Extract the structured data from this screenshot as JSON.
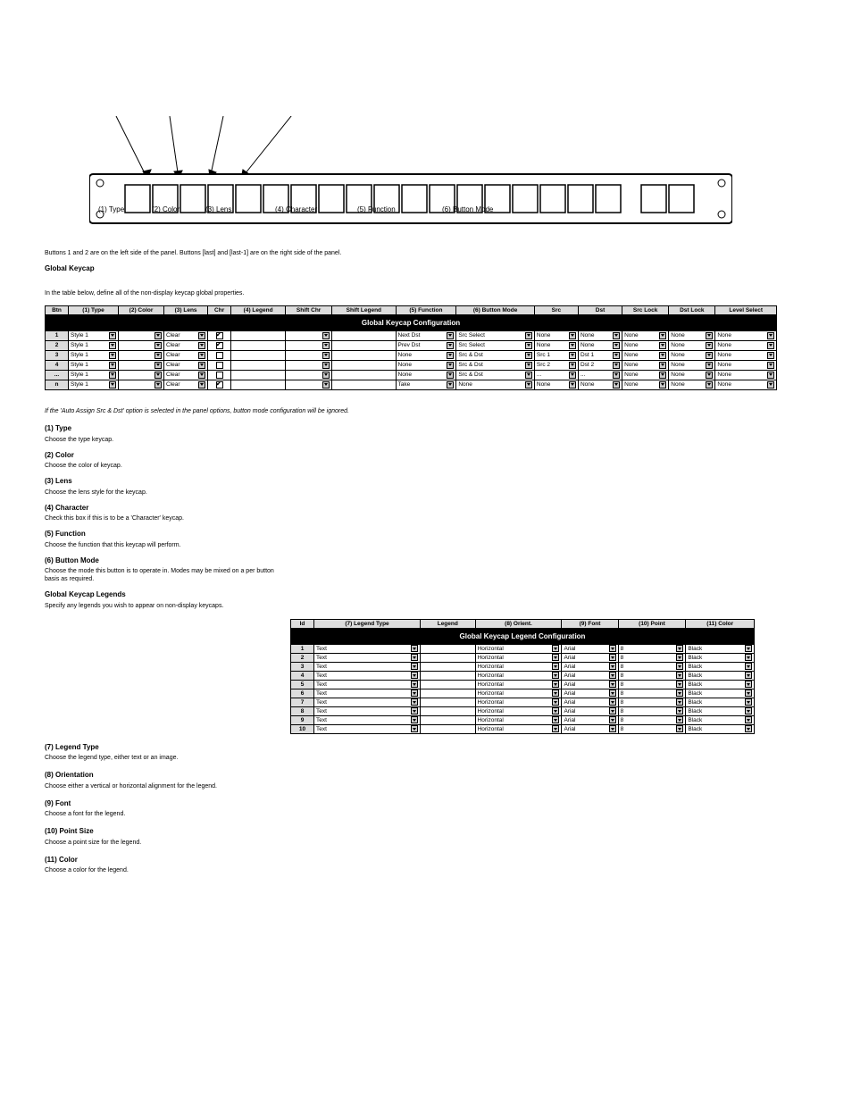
{
  "top_labels": {
    "a": "(1) Type",
    "b": "(2) Color",
    "c": "(3) Lens",
    "d": "(4) Character",
    "e": "(5) Function",
    "f": "(6) Button Mode"
  },
  "panel": {
    "button_count": 18,
    "special_count": 2
  },
  "notes": {
    "arrange_line": "Buttons 1 and 2 are on the left side of the panel. Buttons [last] and [last-1] are on the right side of the panel.",
    "arrange_heading": "Global Keycap",
    "arrange_body": "In the table below, define all of the non-display keycap global properties.",
    "warning": "If the 'Auto Assign Src & Dst' option is selected in the panel options, button mode configuration will be ignored."
  },
  "table_keycap": {
    "title": "Global Keycap Configuration",
    "headers": [
      "Btn",
      "(1) Type",
      "(2) Color",
      "(3) Lens",
      "Chr",
      "(4) Legend",
      "Shift Chr",
      "Shift Legend",
      "(5) Function",
      "(6) Button Mode",
      "Src",
      "Dst",
      "Src Lock",
      "Dst Lock",
      "Level Select"
    ],
    "rows": [
      {
        "btn": "1",
        "type": "Style 1",
        "lens": "Clear",
        "chr_checked": true,
        "legend": "",
        "shift_legend": "",
        "function": "Next Dst",
        "mode": "Src Select",
        "src": "None",
        "dst": "None",
        "src_lock": "None",
        "dst_lock": "None",
        "level": "None"
      },
      {
        "btn": "2",
        "type": "Style 1",
        "lens": "Clear",
        "chr_checked": true,
        "legend": "",
        "shift_legend": "",
        "function": "Prev Dst",
        "mode": "Src Select",
        "src": "None",
        "dst": "None",
        "src_lock": "None",
        "dst_lock": "None",
        "level": "None"
      },
      {
        "btn": "3",
        "type": "Style 1",
        "lens": "Clear",
        "chr_checked": false,
        "legend": "",
        "shift_legend": "",
        "function": "None",
        "mode": "Src & Dst",
        "src": "Src 1",
        "dst": "Dst 1",
        "src_lock": "None",
        "dst_lock": "None",
        "level": "None"
      },
      {
        "btn": "4",
        "type": "Style 1",
        "lens": "Clear",
        "chr_checked": false,
        "legend": "",
        "shift_legend": "",
        "function": "None",
        "mode": "Src & Dst",
        "src": "Src 2",
        "dst": "Dst 2",
        "src_lock": "None",
        "dst_lock": "None",
        "level": "None"
      },
      {
        "btn": "...",
        "type": "Style 1",
        "lens": "Clear",
        "chr_checked": false,
        "legend": "",
        "shift_legend": "",
        "function": "None",
        "mode": "Src & Dst",
        "src": "...",
        "dst": "...",
        "src_lock": "None",
        "dst_lock": "None",
        "level": "None"
      },
      {
        "btn": "n",
        "type": "Style 1",
        "lens": "Clear",
        "chr_checked": true,
        "legend": "",
        "shift_legend": "",
        "function": "Take",
        "mode": "None",
        "src": "None",
        "dst": "None",
        "src_lock": "None",
        "dst_lock": "None",
        "level": "None"
      }
    ]
  },
  "desc": {
    "type_h": "(1) Type",
    "type_p": "Choose the type keycap.",
    "color_h": "(2) Color",
    "color_p": "Choose the color of keycap.",
    "lens_h": "(3) Lens",
    "lens_p": "Choose the lens style for the keycap.",
    "char_h": "(4) Character",
    "char_p": "Check this box if this is to be a 'Character' keycap.",
    "func_h": "(5) Function",
    "func_p": "Choose the function that this keycap will perform."
  },
  "desc2": {
    "mode_h": "(6) Button Mode",
    "mode_p": "Choose the mode this button is to operate in. Modes may be mixed on a per button basis as required.",
    "cap_h": "Global Keycap Legends",
    "cap_p": "Specify any legends you wish to appear on non-display keycaps."
  },
  "table_cap": {
    "title": "Global Keycap Legend Configuration",
    "headers": [
      "Id",
      "(7) Legend Type",
      "Legend",
      "(8) Orient.",
      "(9) Font",
      "(10) Point",
      "(11) Color"
    ],
    "rows": [
      {
        "id": "1",
        "type": "Text",
        "orient": "Horizontal",
        "font": "Arial",
        "point": "8",
        "color": "Black"
      },
      {
        "id": "2",
        "type": "Text",
        "orient": "Horizontal",
        "font": "Arial",
        "point": "8",
        "color": "Black"
      },
      {
        "id": "3",
        "type": "Text",
        "orient": "Horizontal",
        "font": "Arial",
        "point": "8",
        "color": "Black"
      },
      {
        "id": "4",
        "type": "Text",
        "orient": "Horizontal",
        "font": "Arial",
        "point": "8",
        "color": "Black"
      },
      {
        "id": "5",
        "type": "Text",
        "orient": "Horizontal",
        "font": "Arial",
        "point": "8",
        "color": "Black"
      },
      {
        "id": "6",
        "type": "Text",
        "orient": "Horizontal",
        "font": "Arial",
        "point": "8",
        "color": "Black"
      },
      {
        "id": "7",
        "type": "Text",
        "orient": "Horizontal",
        "font": "Arial",
        "point": "8",
        "color": "Black"
      },
      {
        "id": "8",
        "type": "Text",
        "orient": "Horizontal",
        "font": "Arial",
        "point": "8",
        "color": "Black"
      },
      {
        "id": "9",
        "type": "Text",
        "orient": "Horizontal",
        "font": "Arial",
        "point": "8",
        "color": "Black"
      },
      {
        "id": "10",
        "type": "Text",
        "orient": "Horizontal",
        "font": "Arial",
        "point": "8",
        "color": "Black"
      }
    ]
  },
  "legend_notes": {
    "type_h": "(7) Legend Type",
    "type_p": "Choose the legend type, either text or an image.",
    "orient_h": "(8) Orientation",
    "orient_p": "Choose either a vertical or horizontal alignment for the legend.",
    "font_h": "(9) Font",
    "font_p": "Choose a font for the legend.",
    "point_h": "(10) Point Size",
    "point_p": "Choose a point size for the legend.",
    "color_h": "(11) Color",
    "color_p": "Choose a color for the legend."
  }
}
